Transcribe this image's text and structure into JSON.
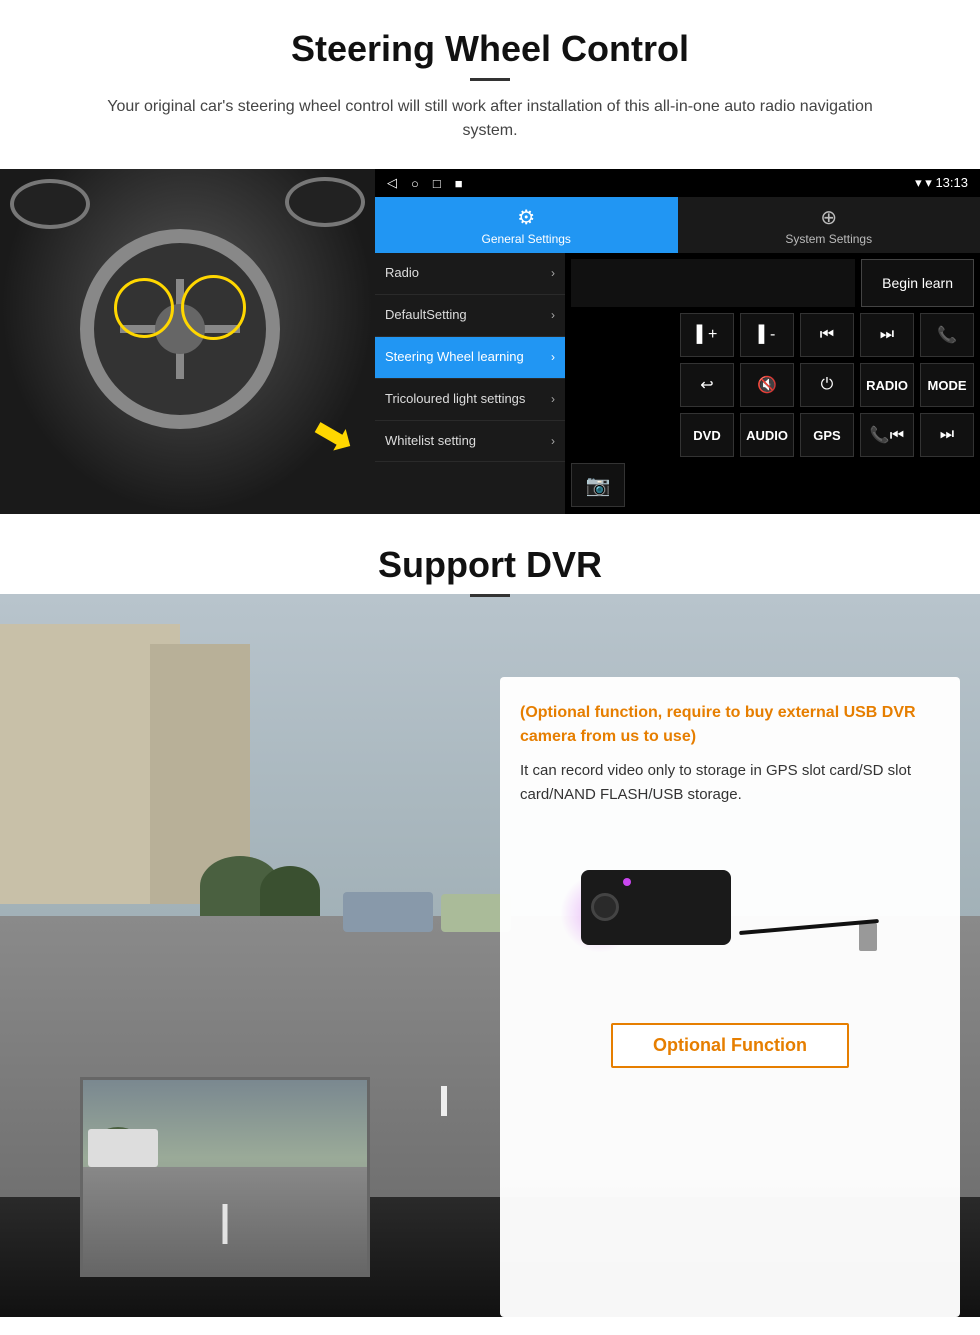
{
  "steering_section": {
    "title": "Steering Wheel Control",
    "description": "Your original car's steering wheel control will still work after installation of this all-in-one auto radio navigation system.",
    "statusbar": {
      "time": "13:13",
      "nav_back": "◁",
      "nav_home": "○",
      "nav_recent": "□",
      "nav_menu": "■"
    },
    "tabs": {
      "general": "General Settings",
      "system": "System Settings"
    },
    "menu_items": [
      {
        "label": "Radio",
        "active": false
      },
      {
        "label": "DefaultSetting",
        "active": false
      },
      {
        "label": "Steering Wheel learning",
        "active": true
      },
      {
        "label": "Tricoloured light settings",
        "active": false
      },
      {
        "label": "Whitelist setting",
        "active": false
      }
    ],
    "begin_learn_label": "Begin learn",
    "control_buttons": [
      [
        "vol+",
        "vol-",
        "⏮",
        "⏭",
        "📞"
      ],
      [
        "↩",
        "🔇×",
        "⏻",
        "RADIO",
        "MODE"
      ],
      [
        "DVD",
        "AUDIO",
        "GPS",
        "📞⏮",
        "⏭"
      ]
    ]
  },
  "dvr_section": {
    "title": "Support DVR",
    "card": {
      "title_text": "(Optional function, require to buy external USB DVR camera from us to use)",
      "body_text": "It can record video only to storage in GPS slot card/SD slot card/NAND FLASH/USB storage.",
      "optional_button_label": "Optional Function"
    }
  }
}
